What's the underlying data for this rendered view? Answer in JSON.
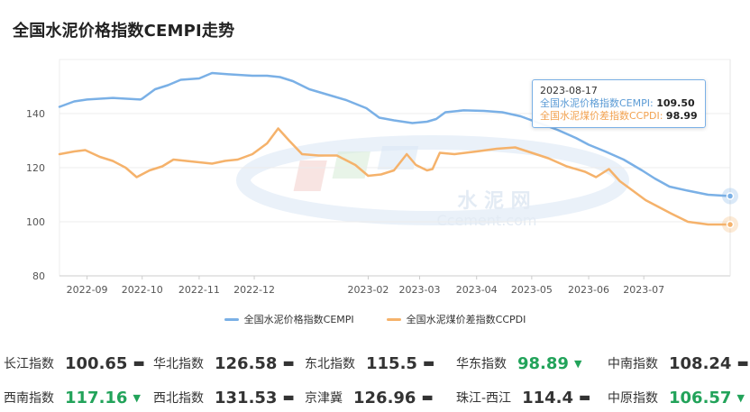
{
  "title": "全国水泥价格指数CEMPI走势",
  "watermark": {
    "line1": "水 泥 网",
    "line2": "Ccement.com"
  },
  "tooltip": {
    "date": "2023-08-17",
    "row1_label": "全国水泥价格指数CEMPI:",
    "row1_value": "109.50",
    "row2_label": "全国水泥煤价差指数CCPDI:",
    "row2_value": "98.99"
  },
  "legend": {
    "items": [
      {
        "label": "全国水泥价格指数CEMPI",
        "color": "#7ab0e6"
      },
      {
        "label": "全国水泥煤价差指数CCPDI",
        "color": "#f5b26b"
      }
    ]
  },
  "regions": [
    {
      "name": "长江指数",
      "value": "100.65",
      "trend": "flat"
    },
    {
      "name": "华北指数",
      "value": "126.58",
      "trend": "flat"
    },
    {
      "name": "东北指数",
      "value": "115.5",
      "trend": "flat"
    },
    {
      "name": "华东指数",
      "value": "98.89",
      "trend": "down"
    },
    {
      "name": "中南指数",
      "value": "108.24",
      "trend": "flat"
    },
    {
      "name": "西南指数",
      "value": "117.16",
      "trend": "down"
    },
    {
      "name": "西北指数",
      "value": "131.53",
      "trend": "flat"
    },
    {
      "name": "京津冀",
      "value": "126.96",
      "trend": "flat"
    },
    {
      "name": "珠江-西江",
      "value": "114.4",
      "trend": "flat"
    },
    {
      "name": "中原指数",
      "value": "106.57",
      "trend": "down"
    }
  ],
  "trend_symbols": {
    "flat": "▬",
    "down": "▼"
  },
  "chart_data": {
    "type": "line",
    "x_start": "2022-08-17",
    "x_end": "2023-08-17",
    "x_ticks": [
      "2022-09",
      "2022-10",
      "2022-11",
      "2022-12",
      "2023-02",
      "2023-03",
      "2023-04",
      "2023-05",
      "2023-06",
      "2023-07"
    ],
    "ylim": [
      80,
      160
    ],
    "y_ticks": [
      80,
      100,
      120,
      140
    ],
    "grid": "horizontal",
    "legend_position": "bottom",
    "series": [
      {
        "name": "全国水泥价格指数CEMPI",
        "color": "#7ab0e6",
        "points": [
          [
            "2022-08-17",
            142.5
          ],
          [
            "2022-08-25",
            144.5
          ],
          [
            "2022-09-01",
            145.2
          ],
          [
            "2022-09-15",
            145.8
          ],
          [
            "2022-09-30",
            145.2
          ],
          [
            "2022-10-01",
            145.5
          ],
          [
            "2022-10-08",
            149
          ],
          [
            "2022-10-15",
            150.5
          ],
          [
            "2022-10-22",
            152.5
          ],
          [
            "2022-11-01",
            153
          ],
          [
            "2022-11-08",
            155
          ],
          [
            "2022-11-18",
            154.5
          ],
          [
            "2022-11-30",
            154
          ],
          [
            "2022-12-08",
            154
          ],
          [
            "2022-12-15",
            153.5
          ],
          [
            "2022-12-22",
            152
          ],
          [
            "2022-12-31",
            149
          ],
          [
            "2023-01-10",
            147
          ],
          [
            "2023-01-20",
            145
          ],
          [
            "2023-01-31",
            142
          ],
          [
            "2023-02-07",
            138.5
          ],
          [
            "2023-02-15",
            137.5
          ],
          [
            "2023-02-25",
            136.5
          ],
          [
            "2023-03-05",
            137
          ],
          [
            "2023-03-10",
            138
          ],
          [
            "2023-03-15",
            140.5
          ],
          [
            "2023-03-25",
            141.2
          ],
          [
            "2023-04-05",
            141
          ],
          [
            "2023-04-15",
            140.5
          ],
          [
            "2023-04-25",
            139
          ],
          [
            "2023-05-05",
            136.5
          ],
          [
            "2023-05-15",
            134
          ],
          [
            "2023-05-25",
            131
          ],
          [
            "2023-06-01",
            128.5
          ],
          [
            "2023-06-10",
            126
          ],
          [
            "2023-06-20",
            123
          ],
          [
            "2023-06-30",
            119
          ],
          [
            "2023-07-07",
            116
          ],
          [
            "2023-07-15",
            113
          ],
          [
            "2023-07-25",
            111.5
          ],
          [
            "2023-08-05",
            110
          ],
          [
            "2023-08-17",
            109.5
          ]
        ]
      },
      {
        "name": "全国水泥煤价差指数CCPDI",
        "color": "#f5b26b",
        "points": [
          [
            "2022-08-17",
            125
          ],
          [
            "2022-08-25",
            126
          ],
          [
            "2022-08-31",
            126.5
          ],
          [
            "2022-09-08",
            124
          ],
          [
            "2022-09-15",
            122.5
          ],
          [
            "2022-09-22",
            120
          ],
          [
            "2022-09-28",
            116.5
          ],
          [
            "2022-10-05",
            119
          ],
          [
            "2022-10-12",
            120.5
          ],
          [
            "2022-10-18",
            123
          ],
          [
            "2022-10-25",
            122.5
          ],
          [
            "2022-11-01",
            122
          ],
          [
            "2022-11-08",
            121.5
          ],
          [
            "2022-11-15",
            122.5
          ],
          [
            "2022-11-22",
            123
          ],
          [
            "2022-11-30",
            125
          ],
          [
            "2022-12-08",
            129
          ],
          [
            "2022-12-14",
            134.5
          ],
          [
            "2022-12-20",
            130
          ],
          [
            "2022-12-27",
            125
          ],
          [
            "2023-01-05",
            124.5
          ],
          [
            "2023-01-15",
            124.5
          ],
          [
            "2023-01-25",
            121
          ],
          [
            "2023-02-01",
            117
          ],
          [
            "2023-02-08",
            117.5
          ],
          [
            "2023-02-15",
            119
          ],
          [
            "2023-02-22",
            125
          ],
          [
            "2023-02-27",
            121
          ],
          [
            "2023-03-05",
            119
          ],
          [
            "2023-03-08",
            119.5
          ],
          [
            "2023-03-12",
            125.5
          ],
          [
            "2023-03-20",
            125
          ],
          [
            "2023-04-01",
            126
          ],
          [
            "2023-04-12",
            127
          ],
          [
            "2023-04-22",
            127.5
          ],
          [
            "2023-05-01",
            125.5
          ],
          [
            "2023-05-10",
            123.5
          ],
          [
            "2023-05-20",
            120.5
          ],
          [
            "2023-05-30",
            118.5
          ],
          [
            "2023-06-05",
            116.5
          ],
          [
            "2023-06-12",
            119.5
          ],
          [
            "2023-06-18",
            115
          ],
          [
            "2023-06-25",
            111.5
          ],
          [
            "2023-07-02",
            108
          ],
          [
            "2023-07-09",
            105.5
          ],
          [
            "2023-07-16",
            103
          ],
          [
            "2023-07-25",
            100
          ],
          [
            "2023-08-05",
            99
          ],
          [
            "2023-08-17",
            98.99
          ]
        ]
      }
    ]
  }
}
